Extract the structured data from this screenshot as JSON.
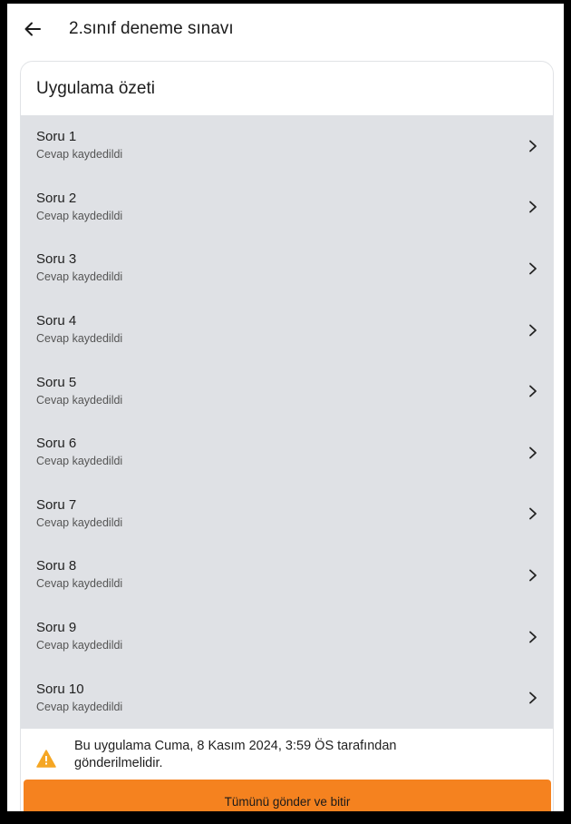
{
  "appbar": {
    "title": "2.sınıf deneme sınavı"
  },
  "summary": {
    "title": "Uygulama özeti",
    "items": [
      {
        "title": "Soru 1",
        "status": "Cevap kaydedildi"
      },
      {
        "title": "Soru 2",
        "status": "Cevap kaydedildi"
      },
      {
        "title": "Soru 3",
        "status": "Cevap kaydedildi"
      },
      {
        "title": "Soru 4",
        "status": "Cevap kaydedildi"
      },
      {
        "title": "Soru 5",
        "status": "Cevap kaydedildi"
      },
      {
        "title": "Soru 6",
        "status": "Cevap kaydedildi"
      },
      {
        "title": "Soru 7",
        "status": "Cevap kaydedildi"
      },
      {
        "title": "Soru 8",
        "status": "Cevap kaydedildi"
      },
      {
        "title": "Soru 9",
        "status": "Cevap kaydedildi"
      },
      {
        "title": "Soru 10",
        "status": "Cevap kaydedildi"
      }
    ]
  },
  "notice": {
    "text": "Bu uygulama Cuma, 8 Kasım 2024, 3:59 ÖS tarafından gönderilmelidir."
  },
  "actions": {
    "submit_label": "Tümünü gönder ve bitir"
  },
  "colors": {
    "accent": "#f5821f",
    "list_bg": "#dfe1e5",
    "warning": "#f5a623"
  },
  "icons": {
    "back": "arrow-left-icon",
    "chevron": "chevron-right-icon",
    "warning": "warning-triangle-icon"
  }
}
